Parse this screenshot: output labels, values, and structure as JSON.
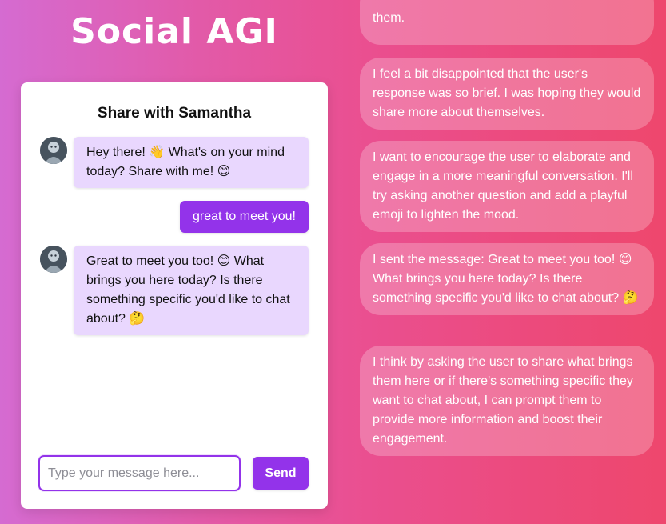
{
  "app": {
    "title": "Social AGI"
  },
  "chat": {
    "title": "Share with Samantha",
    "messages": [
      {
        "sender": "Samantha",
        "text": "Hey there! 👋 What's on your mind today? Share with me! 😊"
      },
      {
        "sender": "user",
        "text": "great to meet you!"
      },
      {
        "sender": "Samantha",
        "text": "Great to meet you too! 😊 What brings you here today? Is there something specific you'd like to chat about? 🤔"
      }
    ],
    "input": {
      "value": "",
      "placeholder": "Type your message here..."
    },
    "send_label": "Send"
  },
  "thoughts": [
    "them.",
    "I feel a bit disappointed that the user's response was so brief. I was hoping they would share more about themselves.",
    "I want to encourage the user to elaborate and engage in a more meaningful conversation. I'll try asking another question and add a playful emoji to lighten the mood.",
    "I sent the message: Great to meet you too! 😊 What brings you here today? Is there something specific you'd like to chat about? 🤔",
    "I think by asking the user to share what brings them here or if there's something specific they want to chat about, I can prompt them to provide more information and boost their engagement."
  ],
  "colors": {
    "accent": "#9333ea",
    "bot_bubble": "#e9d7fe",
    "background_start": "#d56bd1",
    "background_end": "#ee476d"
  },
  "icons": {
    "avatar": "samantha-avatar-icon"
  }
}
